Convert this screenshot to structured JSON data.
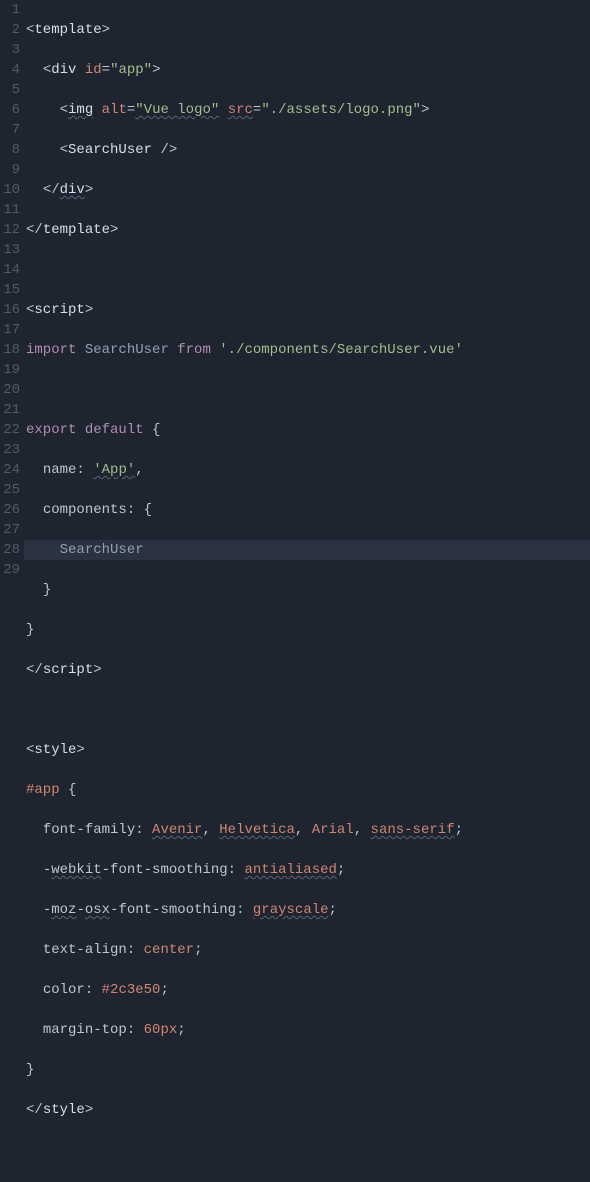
{
  "lineNumbers": [
    "1",
    "2",
    "3",
    "4",
    "5",
    "6",
    "7",
    "8",
    "9",
    "10",
    "11",
    "12",
    "13",
    "14",
    "15",
    "16",
    "17",
    "18",
    "19",
    "20",
    "21",
    "22",
    "23",
    "24",
    "25",
    "26",
    "27",
    "28",
    "29"
  ],
  "currentLine": 14,
  "code": {
    "l1_open": "<",
    "l1_tag": "template",
    "l1_close": ">",
    "l2_indent": "  ",
    "l2_open": "<",
    "l2_tag": "div",
    "l2_sp": " ",
    "l2_attr": "id",
    "l2_eq": "=",
    "l2_val": "\"app\"",
    "l2_close": ">",
    "l3_indent": "    ",
    "l3_open": "<",
    "l3_tag": "img",
    "l3_sp1": " ",
    "l3_attr1": "alt",
    "l3_eq1": "=",
    "l3_val1": "\"Vue logo\"",
    "l3_sp2": " ",
    "l3_attr2": "src",
    "l3_eq2": "=",
    "l3_val2": "\"./assets/logo.png\"",
    "l3_close": ">",
    "l4_indent": "    ",
    "l4_open": "<",
    "l4_tag": "SearchUser",
    "l4_sp": " ",
    "l4_close": "/>",
    "l5_indent": "  ",
    "l5_open": "</",
    "l5_tag": "div",
    "l5_close": ">",
    "l6_open": "</",
    "l6_tag": "template",
    "l6_close": ">",
    "l8_open": "<",
    "l8_tag": "script",
    "l8_close": ">",
    "l9_kw": "import",
    "l9_sp1": " ",
    "l9_name": "SearchUser",
    "l9_sp2": " ",
    "l9_from": "from",
    "l9_sp3": " ",
    "l9_path": "'./components/SearchUser.vue'",
    "l11_kw": "export",
    "l11_sp": " ",
    "l11_def": "default",
    "l11_sp2": " ",
    "l11_brace": "{",
    "l12_indent": "  ",
    "l12_prop": "name",
    "l12_colon": ": ",
    "l12_val": "'App'",
    "l12_comma": ",",
    "l13_indent": "  ",
    "l13_prop": "components",
    "l13_colon": ": ",
    "l13_brace": "{",
    "l14_indent": "    ",
    "l14_name": "SearchUser",
    "l15_indent": "  ",
    "l15_brace": "}",
    "l16_brace": "}",
    "l17_open": "</",
    "l17_tag": "script",
    "l17_close": ">",
    "l19_open": "<",
    "l19_tag": "style",
    "l19_close": ">",
    "l20_sel": "#app",
    "l20_sp": " ",
    "l20_brace": "{",
    "l21_indent": "  ",
    "l21_prop": "font-family",
    "l21_colon": ": ",
    "l21_v1": "Avenir",
    "l21_c1": ", ",
    "l21_v2": "Helvetica",
    "l21_c2": ", ",
    "l21_v3": "Arial",
    "l21_c3": ", ",
    "l21_v4": "sans-serif",
    "l21_semi": ";",
    "l22_indent": "  ",
    "l22_p1": "-",
    "l22_p2": "webkit",
    "l22_p3": "-font-smoothing",
    "l22_colon": ": ",
    "l22_val": "antialiased",
    "l22_semi": ";",
    "l23_indent": "  ",
    "l23_p1": "-",
    "l23_p2": "moz",
    "l23_p3": "-",
    "l23_p4": "osx",
    "l23_p5": "-font-smoothing",
    "l23_colon": ": ",
    "l23_val": "grayscale",
    "l23_semi": ";",
    "l24_indent": "  ",
    "l24_prop": "text-align",
    "l24_colon": ": ",
    "l24_val": "center",
    "l24_semi": ";",
    "l25_indent": "  ",
    "l25_prop": "color",
    "l25_colon": ": ",
    "l25_val": "#2c3e50",
    "l25_semi": ";",
    "l26_indent": "  ",
    "l26_prop": "margin-top",
    "l26_colon": ": ",
    "l26_val": "60px",
    "l26_semi": ";",
    "l27_brace": "}",
    "l28_open": "</",
    "l28_tag": "style",
    "l28_close": ">"
  }
}
